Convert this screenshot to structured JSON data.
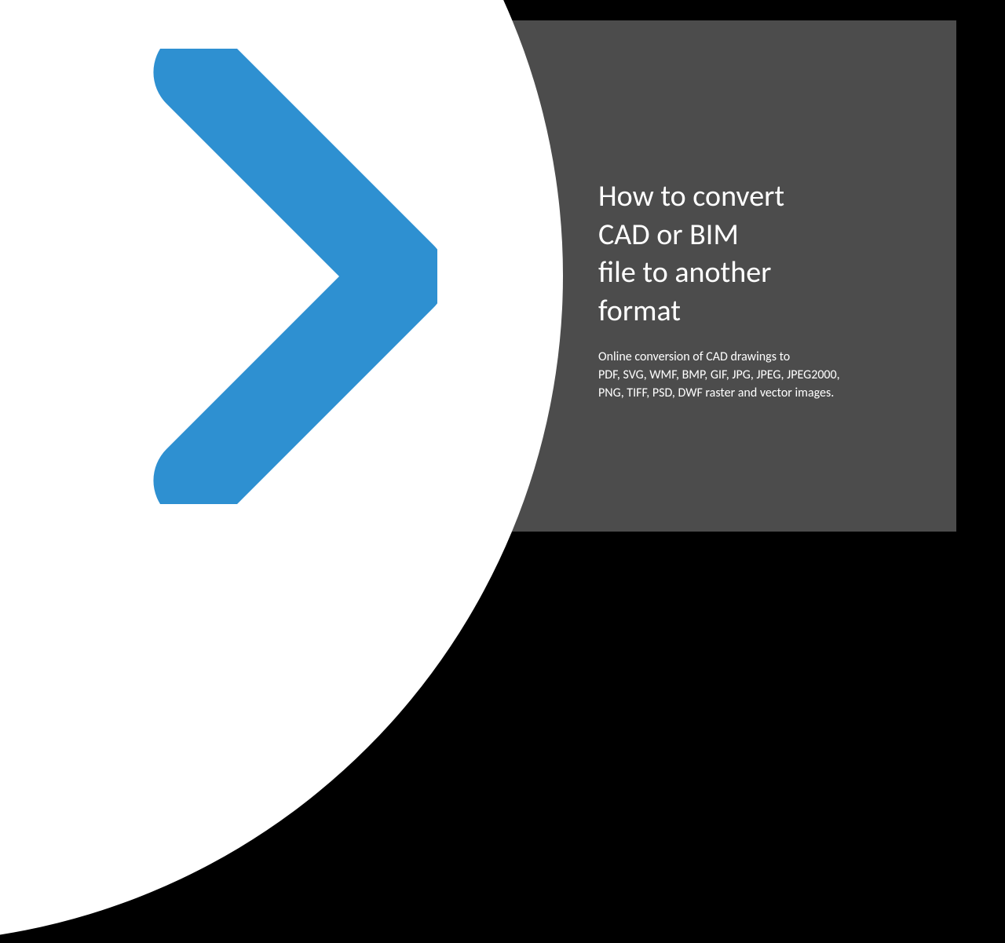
{
  "title_line1": "How to convert",
  "title_line2": "CAD or BIM",
  "title_line3": "file to another",
  "title_line4": "format",
  "subtitle_line1": "Online conversion of CAD drawings to",
  "subtitle_line2": "PDF, SVG, WMF, BMP, GIF, JPG, JPEG, JPEG2000,",
  "subtitle_line3": "PNG, TIFF, PSD, DWF raster and vector images.",
  "accent_color": "#2e90d1"
}
